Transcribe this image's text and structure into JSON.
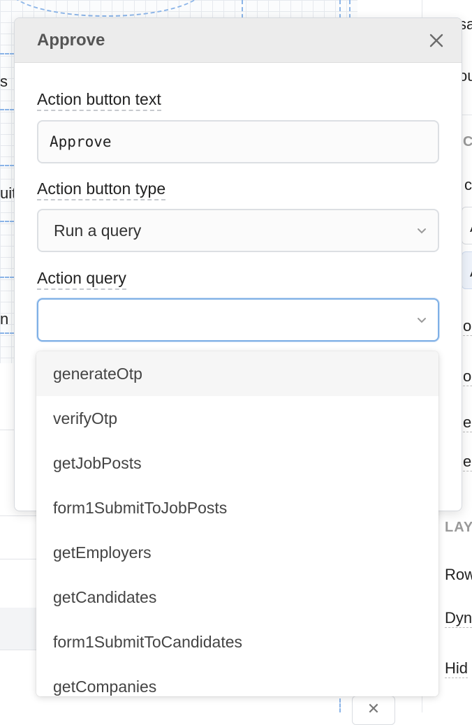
{
  "modal": {
    "title": "Approve",
    "close_icon": "close-icon",
    "fields": {
      "button_text_label": "Action button text",
      "button_text_value": "Approve",
      "button_type_label": "Action button type",
      "button_type_value": "Run a query",
      "query_label": "Action query",
      "query_value": ""
    }
  },
  "dropdown": {
    "options": [
      "generateOtp",
      "verifyOtp",
      "getJobPosts",
      "form1SubmitToJobPosts",
      "getEmployers",
      "getCandidates",
      "form1SubmitToCandidates",
      "getCompanies"
    ],
    "highlighted_index": 0
  },
  "background": {
    "canvas_clips": [
      "s",
      "uit",
      "n"
    ],
    "inspector_clips": [
      "sa",
      "ou",
      "CT",
      "ct",
      "A",
      "A",
      "olu",
      "olu",
      "ec",
      "ele",
      "LAY",
      "Row",
      "Dyn",
      "Hid"
    ]
  },
  "colors": {
    "focus_border": "#7fb0e6",
    "header_bg": "#ececec",
    "canvas_guides": "#8ab4e8"
  }
}
